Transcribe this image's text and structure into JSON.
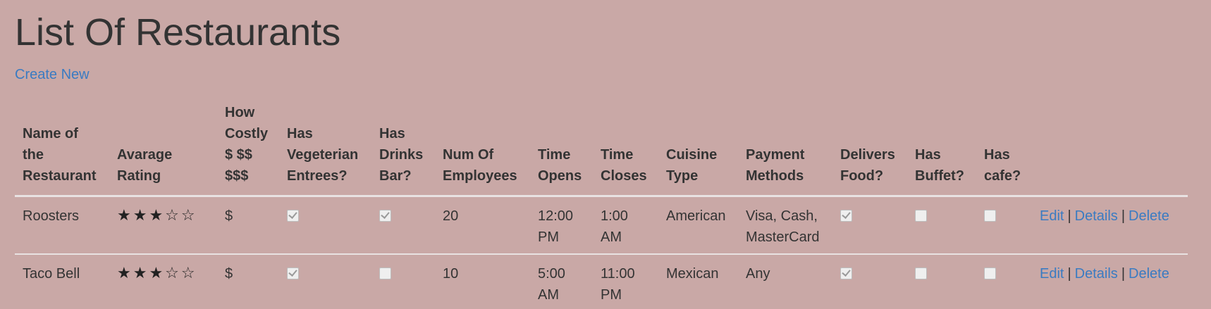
{
  "page": {
    "title": "List Of Restaurants",
    "create_link": "Create New"
  },
  "table": {
    "headers": [
      "Name of the Restaurant",
      "Avarage Rating",
      "How Costly $ $$ $$$",
      "Has Vegeterian Entrees?",
      "Has Drinks Bar?",
      "Num Of Employees",
      "Time Opens",
      "Time Closes",
      "Cuisine Type",
      "Payment Methods",
      "Delivers Food?",
      "Has Buffet?",
      "Has cafe?"
    ],
    "rows": [
      {
        "name": "Roosters",
        "rating_stars": "★★★☆☆",
        "rating": 3,
        "cost": "$",
        "vegetarian": true,
        "drinks_bar": true,
        "employees": "20",
        "opens": "12:00 PM",
        "closes": "1:00 AM",
        "cuisine": "American",
        "payment": "Visa, Cash, MasterCard",
        "delivers": true,
        "buffet": false,
        "cafe": false
      },
      {
        "name": "Taco Bell",
        "rating_stars": "★★★☆☆",
        "rating": 3,
        "cost": "$",
        "vegetarian": true,
        "drinks_bar": false,
        "employees": "10",
        "opens": "5:00 AM",
        "closes": "11:00 PM",
        "cuisine": "Mexican",
        "payment": "Any",
        "delivers": true,
        "buffet": false,
        "cafe": false
      }
    ],
    "actions": {
      "edit": "Edit",
      "details": "Details",
      "delete": "Delete",
      "separator": "|"
    }
  },
  "colors": {
    "background": "#c9a8a6",
    "link": "#3a7bc2",
    "text": "#333333",
    "rule": "#e8e2e2"
  }
}
